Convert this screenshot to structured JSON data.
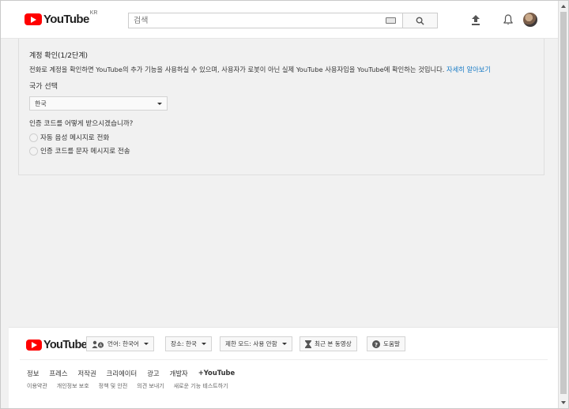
{
  "header": {
    "logo_text": "YouTube",
    "country_code": "KR",
    "search_placeholder": "검색"
  },
  "card": {
    "title": "계정 확인(1/2단계)",
    "description": "전화로 계정을 확인하면 YouTube의 추가 기능을 사용하실 수 있으며, 사용자가 로봇이 아닌 실제 YouTube 사용자임을 YouTube에 확인하는 것입니다.",
    "learn_more": "자세히 알아보기",
    "country_label": "국가 선택",
    "country_value": "한국",
    "method_question": "인증 코드를 어떻게 받으시겠습니까?",
    "options": [
      {
        "label": "자동 음성 메시지로 전화"
      },
      {
        "label": "인증 코드를 문자 메시지로 전송"
      }
    ]
  },
  "footer": {
    "logo_text": "YouTube",
    "language": "언어: 한국어",
    "location": "장소: 한국",
    "restricted": "제한 모드: 사용 안함",
    "history": "최근 본 동영상",
    "help": "도움말",
    "links": [
      "정보",
      "프레스",
      "저작권",
      "크리에이터",
      "광고",
      "개발자",
      "+YouTube"
    ],
    "sublinks": [
      "이용약관",
      "개인정보 보호",
      "정책 및 안전",
      "의견 보내기",
      "새로운 기능 테스트하기"
    ]
  },
  "colors": {
    "brand_red": "#ff0000",
    "link_blue": "#167ac6",
    "background": "#f1f1f1"
  }
}
